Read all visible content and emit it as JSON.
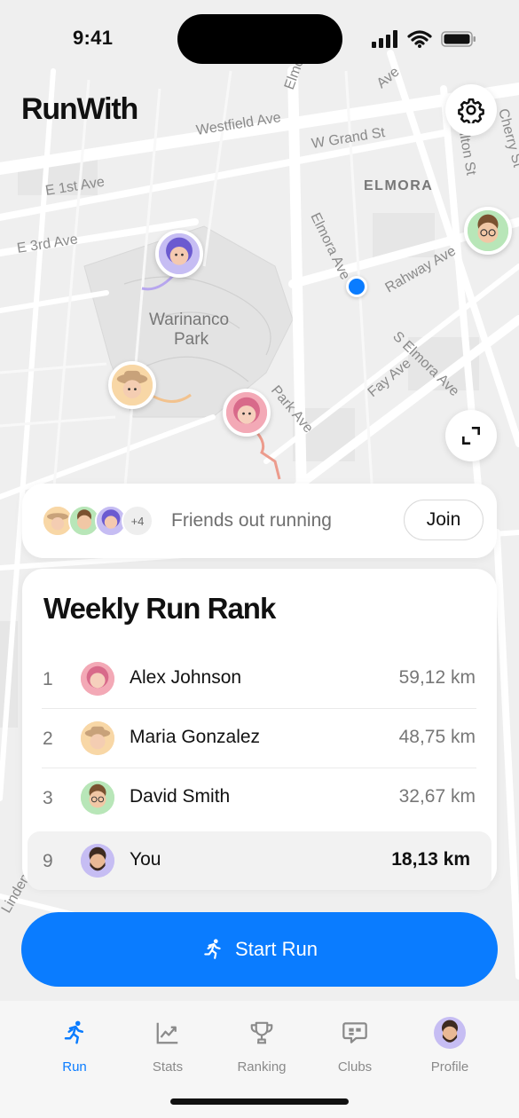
{
  "status_bar": {
    "time": "9:41"
  },
  "app": {
    "title": "RunWith"
  },
  "map": {
    "street_labels": [
      "Westfield Ave",
      "W Grand St",
      "E 1st Ave",
      "E 3rd Ave",
      "ELMORA",
      "Elmora Ave",
      "Rahway Ave",
      "S Elmora Ave",
      "Fay Ave",
      "Park Ave",
      "Warinanco",
      "Park",
      "ilton St",
      "Cherry St",
      "Elmora",
      "Ave",
      "Linden"
    ]
  },
  "friends_banner": {
    "extra_count": "+4",
    "text": "Friends out running",
    "join_label": "Join"
  },
  "ranking": {
    "title": "Weekly Run Rank",
    "rows": [
      {
        "rank": "1",
        "name": "Alex Johnson",
        "distance": "59,12 km"
      },
      {
        "rank": "2",
        "name": "Maria Gonzalez",
        "distance": "48,75 km"
      },
      {
        "rank": "3",
        "name": "David Smith",
        "distance": "32,67 km"
      },
      {
        "rank": "9",
        "name": "You",
        "distance": "18,13 km"
      }
    ]
  },
  "start_button": {
    "label": "Start Run"
  },
  "tabs": [
    {
      "label": "Run",
      "icon": "runner-icon"
    },
    {
      "label": "Stats",
      "icon": "chart-icon"
    },
    {
      "label": "Ranking",
      "icon": "trophy-icon"
    },
    {
      "label": "Clubs",
      "icon": "chat-icon"
    },
    {
      "label": "Profile",
      "icon": "avatar-icon"
    }
  ],
  "colors": {
    "accent": "#0a7cff",
    "background": "#efefef"
  }
}
